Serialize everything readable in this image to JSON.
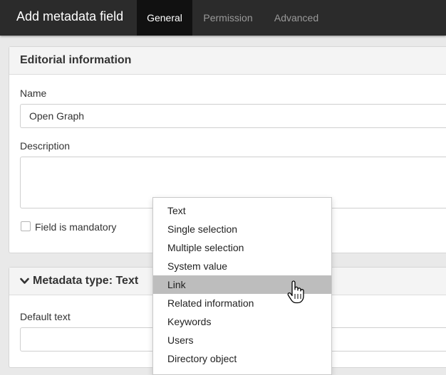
{
  "header": {
    "title": "Add metadata field",
    "tabs": [
      {
        "label": "General",
        "active": true
      },
      {
        "label": "Permission",
        "active": false
      },
      {
        "label": "Advanced",
        "active": false
      }
    ]
  },
  "editorial": {
    "title": "Editorial information",
    "name_label": "Name",
    "name_value": "Open Graph",
    "description_label": "Description",
    "description_value": "",
    "mandatory_label": "Field is mandatory",
    "mandatory_checked": false
  },
  "metadata_type": {
    "title": "Metadata type: Text",
    "expanded_icon": "chevron-down-icon",
    "default_text_label": "Default text",
    "default_text_value": ""
  },
  "type_dropdown": {
    "selected": "Link",
    "options": [
      "Text",
      "Single selection",
      "Multiple selection",
      "System value",
      "Link",
      "Related information",
      "Keywords",
      "Users",
      "Directory object"
    ]
  },
  "colors": {
    "header_bg": "#2b2b2b",
    "active_tab_bg": "#111111",
    "highlight": "#bdbdbd"
  }
}
